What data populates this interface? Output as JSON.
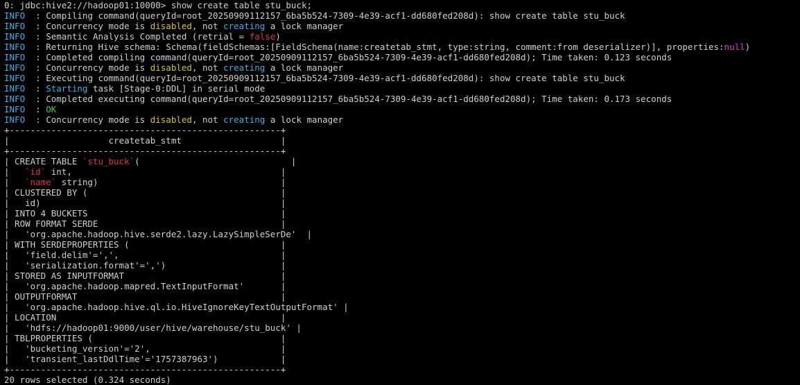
{
  "terminal": {
    "lines": [
      [
        {
          "t": "0: jdbc:hive2://hadoop01:10000> show create table stu_buck;"
        }
      ],
      [
        {
          "t": "INFO",
          "c": "cyan"
        },
        {
          "t": "  : Compiling command(queryId=root_20250909112157_6ba5b524-7309-4e39-acf1-dd680fed208d): show create table stu_buck"
        }
      ],
      [
        {
          "t": "INFO",
          "c": "cyan"
        },
        {
          "t": "  : Concurrency mode is "
        },
        {
          "t": "disabled",
          "c": "yellow"
        },
        {
          "t": ", not "
        },
        {
          "t": "creating",
          "c": "cyan"
        },
        {
          "t": " a lock manager"
        }
      ],
      [
        {
          "t": "INFO",
          "c": "cyan"
        },
        {
          "t": "  : Semantic Analysis Completed (retrial = "
        },
        {
          "t": "false",
          "c": "red"
        },
        {
          "t": ")"
        }
      ],
      [
        {
          "t": "INFO",
          "c": "cyan"
        },
        {
          "t": "  : Returning Hive schema: Schema(fieldSchemas:[FieldSchema(name:createtab_stmt, type:string, comment:from deserializer)], properties:"
        },
        {
          "t": "null",
          "c": "magenta"
        },
        {
          "t": ")"
        }
      ],
      [
        {
          "t": "INFO",
          "c": "cyan"
        },
        {
          "t": "  : Completed compiling command(queryId=root_20250909112157_6ba5b524-7309-4e39-acf1-dd680fed208d); Time taken: 0.123 seconds"
        }
      ],
      [
        {
          "t": "INFO",
          "c": "cyan"
        },
        {
          "t": "  : Concurrency mode is "
        },
        {
          "t": "disabled",
          "c": "yellow"
        },
        {
          "t": ", not "
        },
        {
          "t": "creating",
          "c": "cyan"
        },
        {
          "t": " a lock manager"
        }
      ],
      [
        {
          "t": "INFO",
          "c": "cyan"
        },
        {
          "t": "  : Executing command(queryId=root_20250909112157_6ba5b524-7309-4e39-acf1-dd680fed208d): show create table stu_buck"
        }
      ],
      [
        {
          "t": "INFO",
          "c": "cyan"
        },
        {
          "t": "  : "
        },
        {
          "t": "Starting",
          "c": "cyan"
        },
        {
          "t": " task [Stage-0:DDL] in serial mode"
        }
      ],
      [
        {
          "t": "INFO",
          "c": "cyan"
        },
        {
          "t": "  : Completed executing command(queryId=root_20250909112157_6ba5b524-7309-4e39-acf1-dd680fed208d); Time taken: 0.173 seconds"
        }
      ],
      [
        {
          "t": "INFO",
          "c": "cyan"
        },
        {
          "t": "  : "
        },
        {
          "t": "OK",
          "c": "green"
        }
      ],
      [
        {
          "t": "INFO",
          "c": "cyan"
        },
        {
          "t": "  : Concurrency mode is "
        },
        {
          "t": "disabled",
          "c": "yellow"
        },
        {
          "t": ", not "
        },
        {
          "t": "creating",
          "c": "cyan"
        },
        {
          "t": " a lock manager"
        }
      ],
      [
        {
          "t": "+----------------------------------------------------+"
        }
      ],
      [
        {
          "t": "|                   createtab_stmt                   |"
        }
      ],
      [
        {
          "t": "+----------------------------------------------------+"
        }
      ],
      [
        {
          "t": "| CREATE TABLE "
        },
        {
          "t": "`stu_buck`",
          "c": "red"
        },
        {
          "t": "(                             |"
        }
      ],
      [
        {
          "t": "|   "
        },
        {
          "t": "`id`",
          "c": "red"
        },
        {
          "t": " int,                                        |"
        }
      ],
      [
        {
          "t": "|   "
        },
        {
          "t": "`name`",
          "c": "red"
        },
        {
          "t": " string)                                   |"
        }
      ],
      [
        {
          "t": "| CLUSTERED BY (                                     |"
        }
      ],
      [
        {
          "t": "|   id)                                              |"
        }
      ],
      [
        {
          "t": "| INTO 4 BUCKETS                                     |"
        }
      ],
      [
        {
          "t": "| ROW FORMAT SERDE                                   |"
        }
      ],
      [
        {
          "t": "|   'org.apache.hadoop.hive.serde2.lazy.LazySimpleSerDe'  |"
        }
      ],
      [
        {
          "t": "| WITH SERDEPROPERTIES (                             |"
        }
      ],
      [
        {
          "t": "|   'field.delim'=',',                               |"
        }
      ],
      [
        {
          "t": "|   'serialization.format'=',')                      |"
        }
      ],
      [
        {
          "t": "| STORED AS INPUTFORMAT                              |"
        }
      ],
      [
        {
          "t": "|   'org.apache.hadoop.mapred.TextInputFormat'       |"
        }
      ],
      [
        {
          "t": "| OUTPUTFORMAT                                       |"
        }
      ],
      [
        {
          "t": "|   'org.apache.hadoop.hive.ql.io.HiveIgnoreKeyTextOutputFormat' |"
        }
      ],
      [
        {
          "t": "| LOCATION                                           |"
        }
      ],
      [
        {
          "t": "|   'hdfs://hadoop01:9000/user/hive/warehouse/stu_buck' |"
        }
      ],
      [
        {
          "t": "| TBLPROPERTIES (                                    |"
        }
      ],
      [
        {
          "t": "|   'bucketing_version'='2',                         |"
        }
      ],
      [
        {
          "t": "|   'transient_lastDdlTime'='1757387963')            |"
        }
      ],
      [
        {
          "t": "+----------------------------------------------------+"
        }
      ],
      [
        {
          "t": "20 rows selected (0.324 seconds)"
        }
      ]
    ]
  }
}
